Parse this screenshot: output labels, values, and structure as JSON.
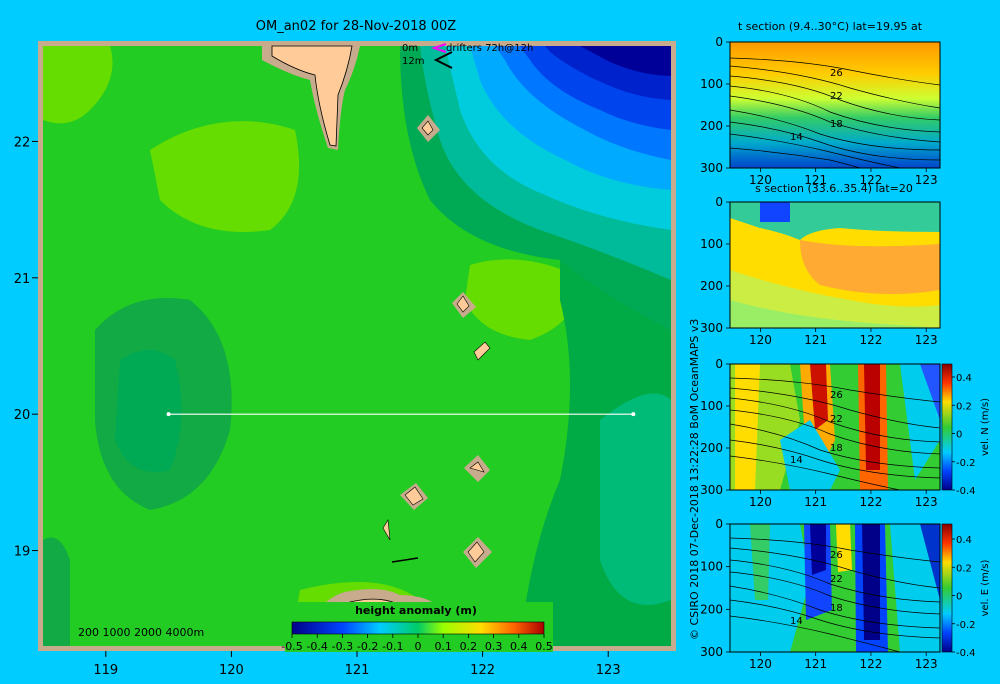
{
  "main_title": "OM_an02 for 28-Nov-2018 00Z",
  "drifters": {
    "depth0": "0m",
    "depth12": "12m",
    "label": "drifters 72h@12h"
  },
  "depth_scale": "200  1000  2000  4000m",
  "credit": "© CSIRO 2018   07-Dec-2018 13:22:28 BoM OceanMAPS v3",
  "colors": {
    "background": "#00ccff",
    "land": "#ffcc99",
    "shelf": "#c8aa8c",
    "section_line": "#ffffff"
  },
  "chart_data": [
    {
      "type": "heatmap",
      "title": "height anomaly (m)",
      "x_ticks": [
        "119",
        "120",
        "121",
        "122",
        "123"
      ],
      "y_ticks": [
        "22",
        "21",
        "20",
        "19"
      ],
      "xlim": [
        118.5,
        123.5
      ],
      "ylim": [
        18.3,
        22.7
      ],
      "colorbar_ticks": [
        "-0.5",
        "-0.4",
        "-0.3",
        "-0.2",
        "-0.1",
        "0",
        "0.1",
        "0.2",
        "0.3",
        "0.4",
        "0.5"
      ],
      "colorbar_range": [
        -0.5,
        0.5
      ],
      "section_line": {
        "lon_start": 119.5,
        "lon_end": 123.2,
        "lat": 20.0
      }
    },
    {
      "type": "heatmap",
      "title": "t section (9.4..30°C) lat=19.95 at",
      "x_ticks": [
        "120",
        "121",
        "122",
        "123"
      ],
      "y_ticks": [
        "0",
        "100",
        "200",
        "300"
      ],
      "contour_labels": [
        "26",
        "22",
        "18",
        "14"
      ]
    },
    {
      "type": "heatmap",
      "title": "s section (33.6..35.4) lat=20",
      "x_ticks": [
        "120",
        "121",
        "122",
        "123"
      ],
      "y_ticks": [
        "0",
        "100",
        "200",
        "300"
      ]
    },
    {
      "type": "heatmap",
      "title": "",
      "x_ticks": [
        "120",
        "121",
        "122",
        "123"
      ],
      "y_ticks": [
        "0",
        "100",
        "200",
        "300"
      ],
      "contour_labels": [
        "26",
        "22",
        "18",
        "14"
      ],
      "colorbar_label": "vel. N (m/s)",
      "colorbar_ticks": [
        "0.4",
        "0.2",
        "0",
        "-0.2",
        "-0.4"
      ]
    },
    {
      "type": "heatmap",
      "title": "",
      "x_ticks": [
        "120",
        "121",
        "122",
        "123"
      ],
      "y_ticks": [
        "0",
        "100",
        "200",
        "300"
      ],
      "contour_labels": [
        "26",
        "22",
        "18",
        "14"
      ],
      "colorbar_label": "vel. E (m/s)",
      "colorbar_ticks": [
        "0.4",
        "0.2",
        "0",
        "-0.2",
        "-0.4"
      ]
    }
  ]
}
